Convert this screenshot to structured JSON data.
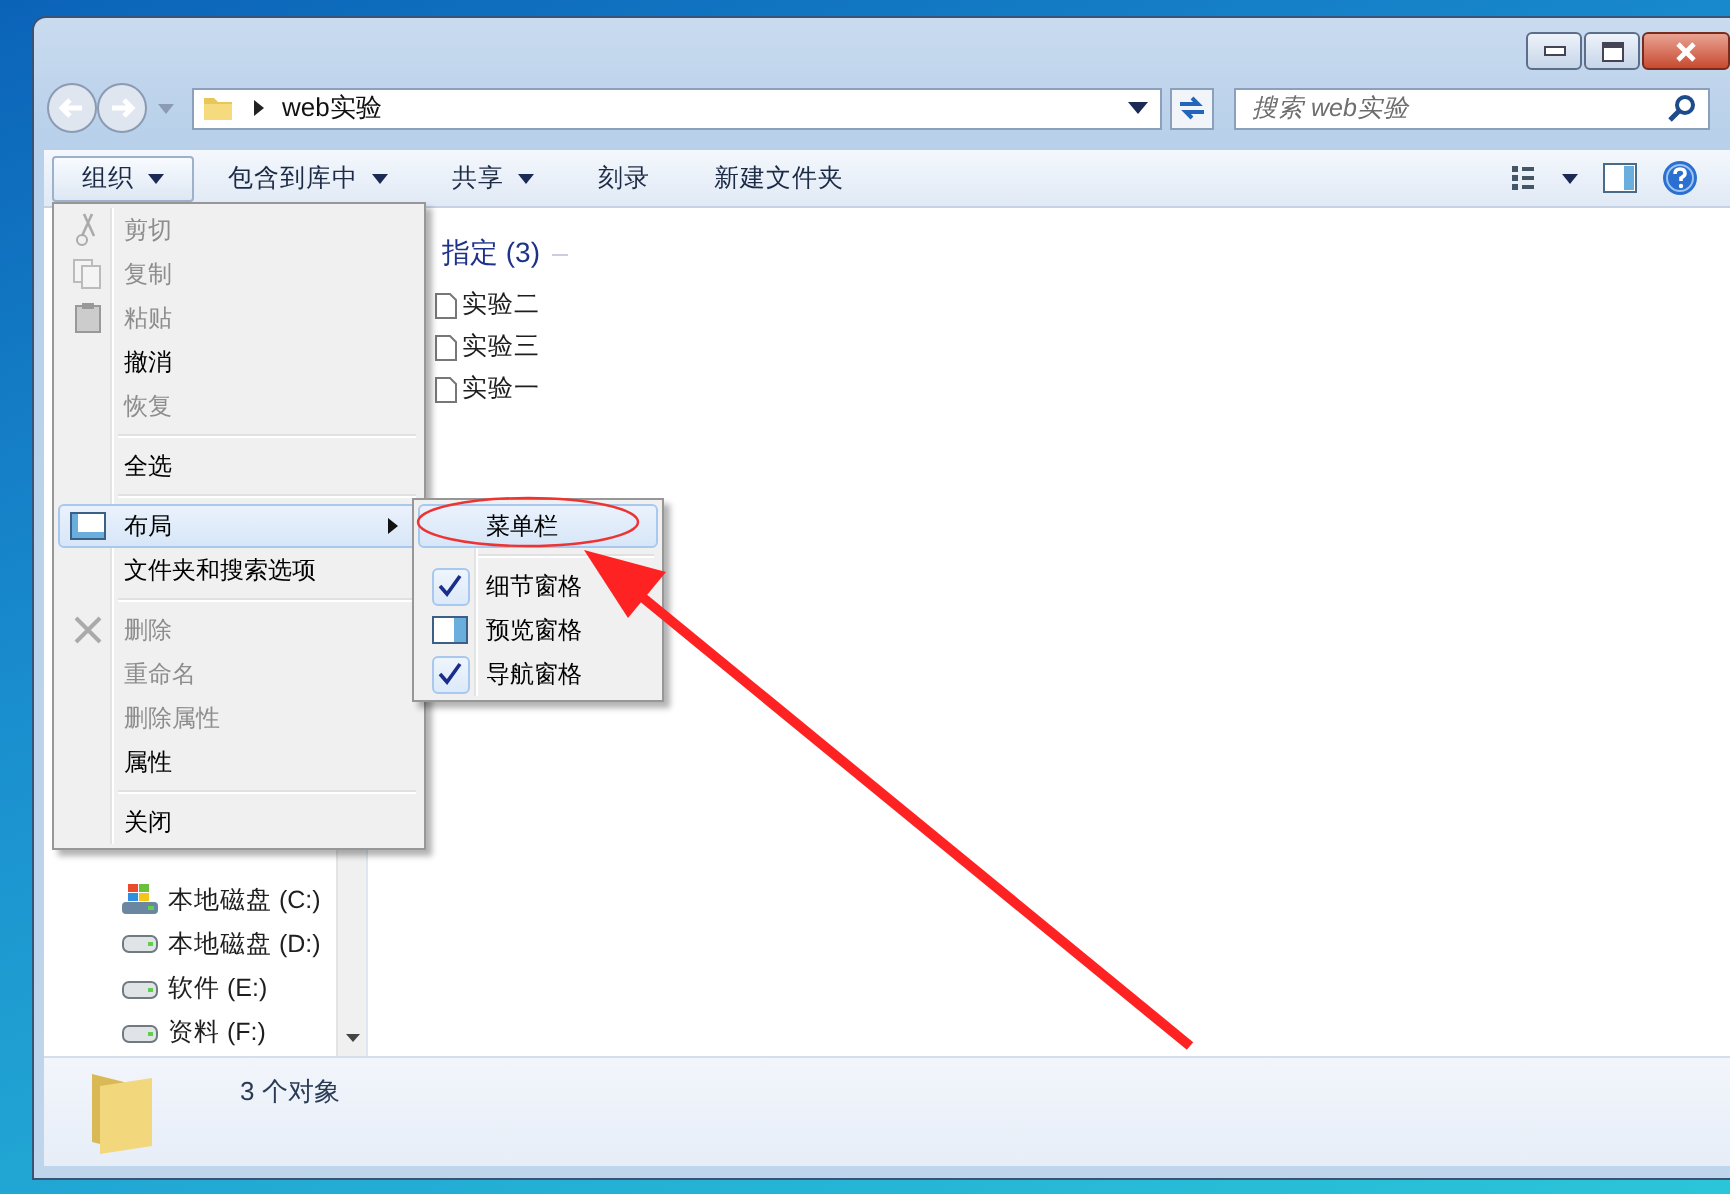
{
  "address_bar": {
    "path": "web实验"
  },
  "search": {
    "placeholder": "搜索 web实验"
  },
  "toolbar": {
    "items": [
      {
        "label": "组织",
        "dropdown": true,
        "selected": true
      },
      {
        "label": "包含到库中",
        "dropdown": true,
        "selected": false
      },
      {
        "label": "共享",
        "dropdown": true,
        "selected": false
      },
      {
        "label": "刻录",
        "dropdown": false,
        "selected": false
      },
      {
        "label": "新建文件夹",
        "dropdown": false,
        "selected": false
      }
    ]
  },
  "navigation": {
    "items": [
      {
        "label": "本地磁盘 (C:)",
        "kind": "system"
      },
      {
        "label": "本地磁盘 (D:)",
        "kind": "drive"
      },
      {
        "label": "软件 (E:)",
        "kind": "drive"
      },
      {
        "label": "资料 (F:)",
        "kind": "drive"
      }
    ]
  },
  "content": {
    "group_header": "指定 (3)",
    "files": [
      "实验二",
      "实验三",
      "实验一"
    ]
  },
  "menu": {
    "items": [
      {
        "kind": "item",
        "label": "剪切",
        "disabled": true
      },
      {
        "kind": "item",
        "label": "复制",
        "disabled": true
      },
      {
        "kind": "item",
        "label": "粘贴",
        "disabled": true
      },
      {
        "kind": "item",
        "label": "撤消",
        "disabled": false
      },
      {
        "kind": "item",
        "label": "恢复",
        "disabled": true
      },
      {
        "kind": "separator"
      },
      {
        "kind": "item",
        "label": "全选",
        "disabled": false
      },
      {
        "kind": "separator"
      },
      {
        "kind": "submenu",
        "label": "布局",
        "disabled": false,
        "selected": true
      },
      {
        "kind": "item",
        "label": "文件夹和搜索选项",
        "disabled": false
      },
      {
        "kind": "separator"
      },
      {
        "kind": "item",
        "label": "删除",
        "disabled": true
      },
      {
        "kind": "item",
        "label": "重命名",
        "disabled": true
      },
      {
        "kind": "item",
        "label": "删除属性",
        "disabled": true
      },
      {
        "kind": "item",
        "label": "属性",
        "disabled": false
      },
      {
        "kind": "separator"
      },
      {
        "kind": "item",
        "label": "关闭",
        "disabled": false
      }
    ]
  },
  "submenu": {
    "items": [
      {
        "kind": "item",
        "label": "菜单栏",
        "checked": false,
        "selected": true
      },
      {
        "kind": "separator"
      },
      {
        "kind": "item",
        "label": "细节窗格",
        "checked": true,
        "selected": false
      },
      {
        "kind": "item",
        "label": "预览窗格",
        "checked": false,
        "selected": false
      },
      {
        "kind": "item",
        "label": "导航窗格",
        "checked": true,
        "selected": false
      }
    ]
  },
  "status_bar": {
    "text": "3 个对象"
  }
}
